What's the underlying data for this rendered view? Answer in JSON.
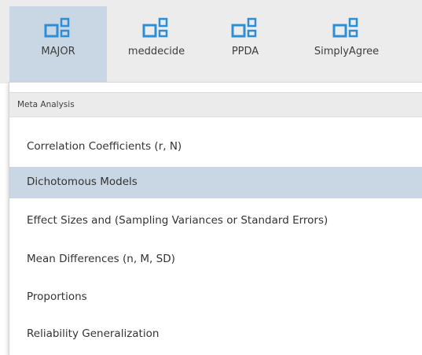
{
  "toolbar": {
    "modules": [
      {
        "label": "MAJOR",
        "icon": "module-icon",
        "active": true
      },
      {
        "label": "meddecide",
        "icon": "module-icon",
        "active": false
      },
      {
        "label": "PPDA",
        "icon": "module-icon",
        "active": false
      },
      {
        "label": "SimplyAgree",
        "icon": "module-icon",
        "active": false
      }
    ],
    "icon_color": "#2c8fd6"
  },
  "menu": {
    "header": "Meta Analysis",
    "items": [
      {
        "label": "Correlation Coefficients (r, N)"
      },
      {
        "label": "Dichotomous Models",
        "highlighted": true
      },
      {
        "label": "Effect Sizes and (Sampling Variances or Standard Errors)"
      },
      {
        "label": "Mean Differences (n, M, SD)"
      },
      {
        "label": "Proportions"
      },
      {
        "label": "Reliability Generalization"
      }
    ]
  }
}
